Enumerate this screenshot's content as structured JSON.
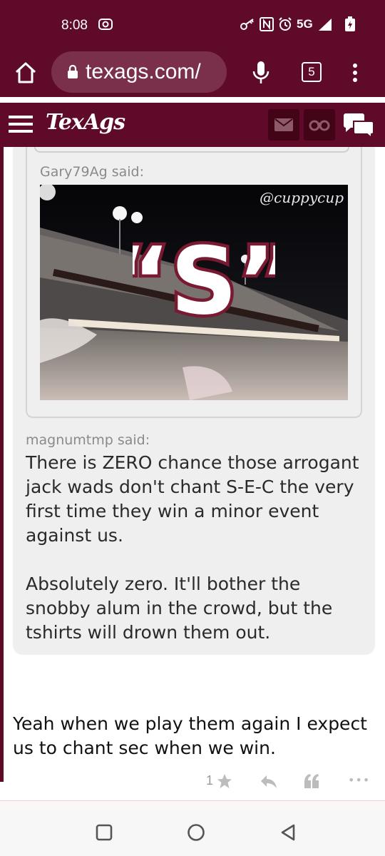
{
  "status": {
    "time": "8:08",
    "network": "5G"
  },
  "browser": {
    "url": "texags.com/",
    "tab_count": "5"
  },
  "site": {
    "logo": "TexAgs"
  },
  "post": {
    "inner_quote_author": "Gary79Ag said:",
    "gif_watermark": "@cuppycup",
    "gif_letter": "“S”",
    "outer_quote_author": "magnumtmp said:",
    "quote_paragraphs": [
      "There is ZERO chance those arrogant jack wads don't chant S-E-C the very first time they win a minor event against us.",
      "Absolutely zero. It'll bother the snobby alum in the crowd, but the tshirts will drown them out."
    ],
    "reply": "Yeah when we play them again I expect us to chant sec when we win.",
    "like_count": "1",
    "more_label": "•••"
  },
  "colors": {
    "brand_maroon": "#5e0a28",
    "quote_bg": "#efefef",
    "muted_text": "#8a8a8a"
  }
}
